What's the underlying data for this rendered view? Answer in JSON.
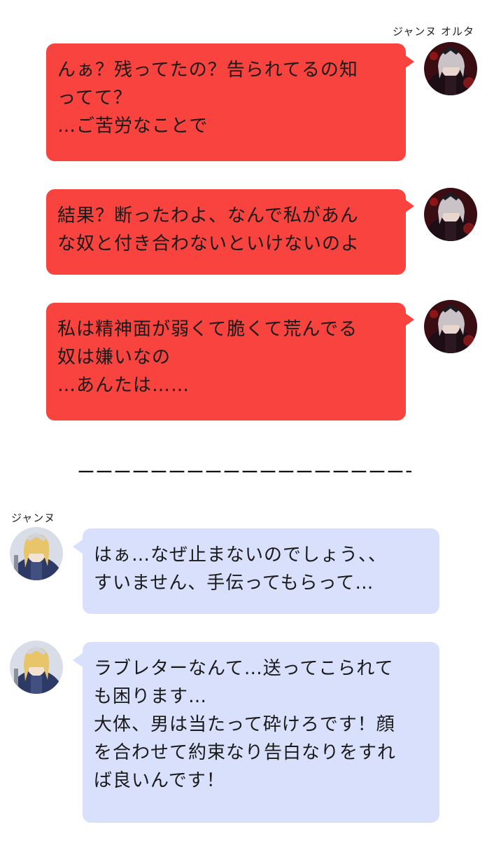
{
  "colors": {
    "right_bubble": "#f8433e",
    "left_bubble": "#d9e0fc",
    "background": "#ffffff"
  },
  "speakers": {
    "right": {
      "name": "ジャンヌ オルタ",
      "avatar_icon": "jeanne-alter-avatar-icon"
    },
    "left": {
      "name": "ジャンヌ",
      "avatar_icon": "jeanne-avatar-icon"
    }
  },
  "messages_right": [
    {
      "lines": [
        "んぁ？残ってたの？告られてるの知",
        "ってて？",
        "…ご苦労なことで"
      ]
    },
    {
      "lines": [
        "結果？断ったわよ、なんで私があん",
        "な奴と付き合わないといけないのよ"
      ]
    },
    {
      "lines": [
        "私は精神面が弱くて脆くて荒んでる",
        "奴は嫌いなの",
        "…あんたは……"
      ]
    }
  ],
  "divider": "ーーーーーーーーーーーーーーーーーーーー",
  "messages_left": [
    {
      "lines": [
        "はぁ…なぜ止まないのでしょう、、",
        "すいません、手伝ってもらって…"
      ]
    },
    {
      "lines": [
        "ラブレターなんて…送ってこられて",
        "も困ります…",
        "大体、男は当たって砕けろです！顔",
        "を合わせて約束なり告白なりをすれ",
        "ば良いんです！"
      ]
    }
  ]
}
